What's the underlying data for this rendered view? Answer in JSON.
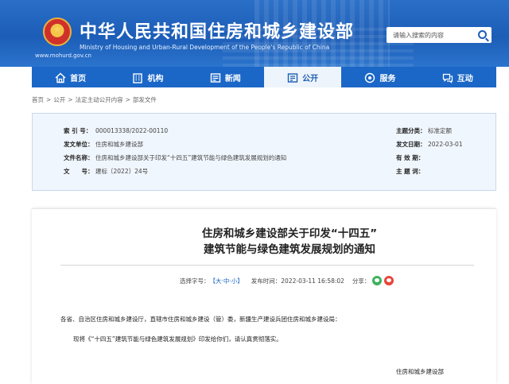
{
  "header": {
    "site_title": "中华人民共和国住房和城乡建设部",
    "site_subtitle": "Ministry of Housing and Urban-Rural Development of the People's Republic of China",
    "site_url": "www.mohurd.gov.cn",
    "search_placeholder": "请输入搜索的内容"
  },
  "nav": {
    "items": [
      {
        "label": "首页",
        "icon": "home-icon"
      },
      {
        "label": "机构",
        "icon": "building-icon"
      },
      {
        "label": "新闻",
        "icon": "news-icon"
      },
      {
        "label": "公开",
        "icon": "open-doc-icon",
        "active": true
      },
      {
        "label": "服务",
        "icon": "service-icon"
      },
      {
        "label": "互动",
        "icon": "chat-icon"
      }
    ]
  },
  "breadcrumb": [
    "首页",
    "公开",
    "法定主动公开内容",
    "部发文件"
  ],
  "info": {
    "index_label": "索 引 号：",
    "index_value": "000013338/2022-00110",
    "issuer_label": "发文单位：",
    "issuer_value": "住房和城乡建设部",
    "name_label": "文件名称：",
    "name_value": "住房和城乡建设部关于印发“十四五”建筑节能与绿色建筑发展规划的通知",
    "number_label": "文　　号：",
    "number_value": "建标〔2022〕24号",
    "category_label": "主题分类：",
    "category_value": "标准定额",
    "date_label": "发文日期：",
    "date_value": "2022-03-01",
    "validity_label": "有 效 期：",
    "validity_value": "",
    "topic_label": "主 题 词：",
    "topic_value": ""
  },
  "document": {
    "title_line1": "住房和城乡建设部关于印发“十四五”",
    "title_line2": "建筑节能与绿色建筑发展规划的通知",
    "font_size_label": "选择字号：",
    "font_size_open": "【",
    "font_large": "大",
    "font_medium": "中",
    "font_small": "小",
    "font_size_close": "】",
    "dot": "·",
    "publish_label": "发布时间：",
    "publish_time": "2022-03-11 16:58:02",
    "share_label": "分享：",
    "addressee": "各省、自治区住房和城乡建设厅，直辖市住房和城乡建设（管）委，新疆生产建设兵团住房和城乡建设局：",
    "paragraph": "现将《“十四五”建筑节能与绿色建筑发展规划》印发给你们，请认真贯彻落实。",
    "signature": "住房和城乡建设部"
  }
}
